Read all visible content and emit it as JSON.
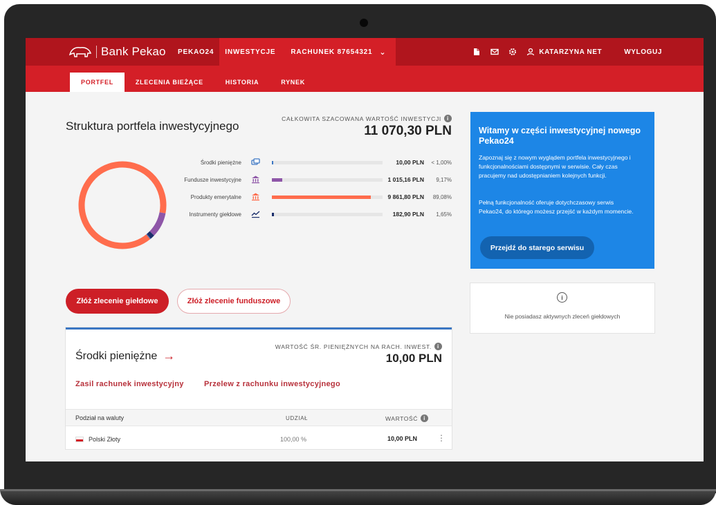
{
  "brand": {
    "name": "Bank Pekao"
  },
  "topnav": {
    "items": [
      {
        "label": "PEKAO24"
      },
      {
        "label": "INWESTYCJE"
      }
    ],
    "account": {
      "label": "RACHUNEK 87654321"
    },
    "user": {
      "name": "KATARZYNA NET"
    },
    "logout": "WYLOGUJ",
    "icons": [
      "document-icon",
      "mail-icon",
      "settings-icon",
      "user-icon"
    ]
  },
  "subnav": {
    "items": [
      {
        "label": "PORTFEL"
      },
      {
        "label": "ZLECENIA BIEŻĄCE"
      },
      {
        "label": "HISTORIA"
      },
      {
        "label": "RYNEK"
      }
    ]
  },
  "portfolio": {
    "title": "Struktura portfela inwestycyjnego",
    "total_label": "CAŁKOWITA SZACOWANA WARTOŚĆ INWESTYCJI",
    "total_value": "11 070,30 PLN",
    "assets": [
      {
        "name": "Środki pieniężne",
        "value": "10,00 PLN",
        "percent": "< 1,00%",
        "share": 0.0009,
        "color": "#3b76c3",
        "icon": "cash-icon"
      },
      {
        "name": "Fundusze inwestycyjne",
        "value": "1 015,16 PLN",
        "percent": "9,17%",
        "share": 0.0917,
        "color": "#8e56a8",
        "icon": "bank-icon"
      },
      {
        "name": "Produkty emerytalne",
        "value": "9 861,80 PLN",
        "percent": "89,08%",
        "share": 0.8908,
        "color": "#ff6d4d",
        "icon": "pension-icon"
      },
      {
        "name": "Instrumenty giełdowe",
        "value": "182,90 PLN",
        "percent": "1,65%",
        "share": 0.0165,
        "color": "#1b2f6b",
        "icon": "chart-line-icon"
      }
    ]
  },
  "actions": {
    "stock_order": "Złóż zlecenie giełdowe",
    "fund_order": "Złóż zlecenie funduszowe"
  },
  "cash": {
    "title": "Środki pieniężne",
    "value_label": "WARTOŚĆ ŚR. PIENIĘŻNYCH NA RACH. INWEST.",
    "value": "10,00 PLN",
    "links": {
      "top_up": "Zasil rachunek inwestycyjny",
      "transfer": "Przelew z rachunku inwestycyjnego"
    },
    "table": {
      "headers": {
        "currency": "Podział na waluty",
        "share": "UDZIAŁ",
        "value": "WARTOŚĆ"
      },
      "rows": [
        {
          "currency": "Polski Złoty",
          "share": "100,00 %",
          "value": "10,00 PLN"
        }
      ]
    }
  },
  "welcome": {
    "title": "Witamy w części inwestycyjnej nowego Pekao24",
    "paragraph1": "Zapoznaj się z nowym wyglądem portfela inwestycyjnego i funkcjonalnościami dostępnymi w serwisie. Cały czas pracujemy nad udostępnianiem kolejnych funkcji.",
    "paragraph2": "Pełną funkcjonalność oferuje dotychczasowy serwis Pekao24, do którego możesz przejść w każdym momencie.",
    "button": "Przejdź do starego serwisu"
  },
  "orders": {
    "empty_text": "Nie posiadasz aktywnych zleceń giełdowych"
  },
  "colors": {
    "topbar": "#b0151d",
    "accent": "#d41f27",
    "welcome_bg": "#1d86e6"
  }
}
